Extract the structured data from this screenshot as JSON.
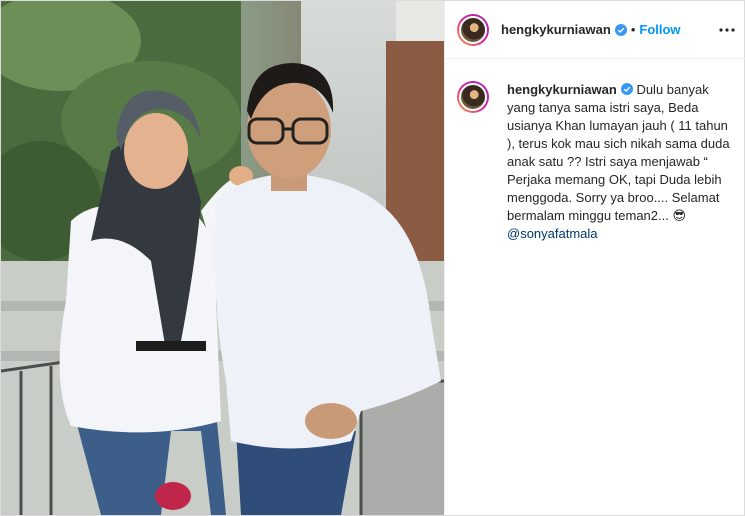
{
  "post": {
    "username": "hengkykurniawan",
    "separator": "•",
    "follow_label": "Follow",
    "more_icon": "more-horizontal-icon",
    "verified_icon": "verified-badge-icon",
    "verified_color": "#3897f0",
    "follow_color": "#0095f6",
    "caption": {
      "username": "hengkykurniawan",
      "text": "Dulu banyak yang tanya sama istri saya, Beda usianya Khan lumayan jauh ( 11 tahun ), terus kok mau sich nikah sama duda anak satu ?? Istri saya menjawab “ Perjaka memang OK, tapi Duda lebih menggoda. Sorry ya broo.... Selamat bermalam minggu teman2... 😎",
      "mention": "@sonyafatmala"
    }
  }
}
